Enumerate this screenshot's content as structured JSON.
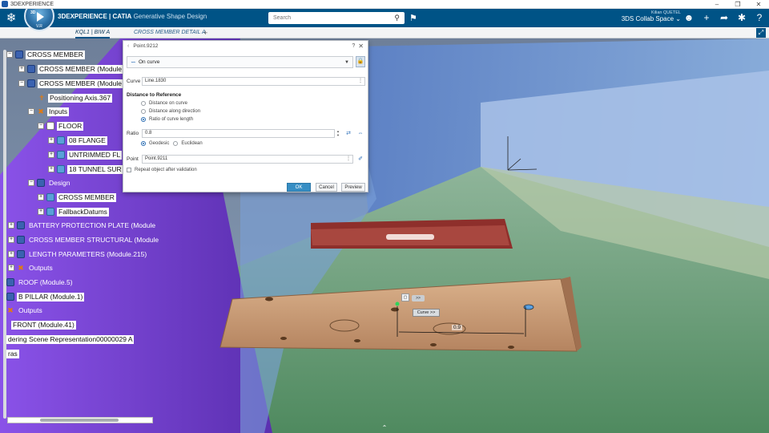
{
  "window": {
    "title": "3DEXPERIENCE"
  },
  "topbar": {
    "compass_version": "V.R",
    "compass_3d": "3D",
    "brand_main": "3DEXPERIENCE",
    "brand_sep": " | CATIA",
    "app_name": "Generative Shape Design",
    "search_placeholder": "Search",
    "user_name": "Kilian QUETEL",
    "collab_space": "3DS Collab Space"
  },
  "tabs": [
    {
      "label": "KQL1 | BIW A",
      "active": true
    },
    {
      "label": "CROSS MEMBER DETAIL A",
      "active": false
    }
  ],
  "tree": {
    "nodes": [
      {
        "label": "CROSS MEMBER"
      },
      {
        "label": "CROSS MEMBER (Module"
      },
      {
        "label": "CROSS MEMBER (Module"
      },
      {
        "label": "Positioning Axis.367"
      },
      {
        "label": "Inputs"
      },
      {
        "label": "FLOOR"
      },
      {
        "label": "08 FLANGE"
      },
      {
        "label": "UNTRIMMED FL"
      },
      {
        "label": "18 TUNNEL SUR"
      },
      {
        "label": "Design"
      },
      {
        "label": "CROSS MEMBER"
      },
      {
        "label": "FallbackDatums"
      },
      {
        "label": "BATTERY PROTECTION PLATE (Module"
      },
      {
        "label": "CROSS MEMBER STRUCTURAL (Module"
      },
      {
        "label": "LENGTH PARAMETERS (Module.215)"
      },
      {
        "label": "Outputs"
      },
      {
        "label": "ROOF (Module.5)"
      },
      {
        "label": "B PILLAR (Module.1)"
      },
      {
        "label": "Outputs"
      },
      {
        "label": "FRONT (Module.41)"
      },
      {
        "label": "dering Scene Representation00000029 A"
      },
      {
        "label": "ras"
      }
    ]
  },
  "dialog": {
    "title": "Point.9212",
    "type_value": "On curve",
    "curve_label": "Curve",
    "curve_value": "Line.1830",
    "section_title": "Distance to Reference",
    "options": [
      "Distance on curve",
      "Distance along direction",
      "Ratio of curve length"
    ],
    "ratio_label": "Ratio",
    "ratio_value": "0.8",
    "geodesic_label": "Geodesic",
    "euclidean_label": "Euclidean",
    "point_label": "Point",
    "point_value": "Point.9211",
    "repeat_label": "Repeat object after validation",
    "ok_label": "OK",
    "cancel_label": "Cancel",
    "preview_label": "Preview"
  },
  "viewport": {
    "more_label": ">>",
    "curve_tag": "Curve >>",
    "dimension_value": "0.9"
  },
  "colors": {
    "topbar": "#005386",
    "floor": "#6a9a6e",
    "purple": "#7a3fd6",
    "part": "#c99a6e",
    "red_part": "#8e2f2b"
  }
}
